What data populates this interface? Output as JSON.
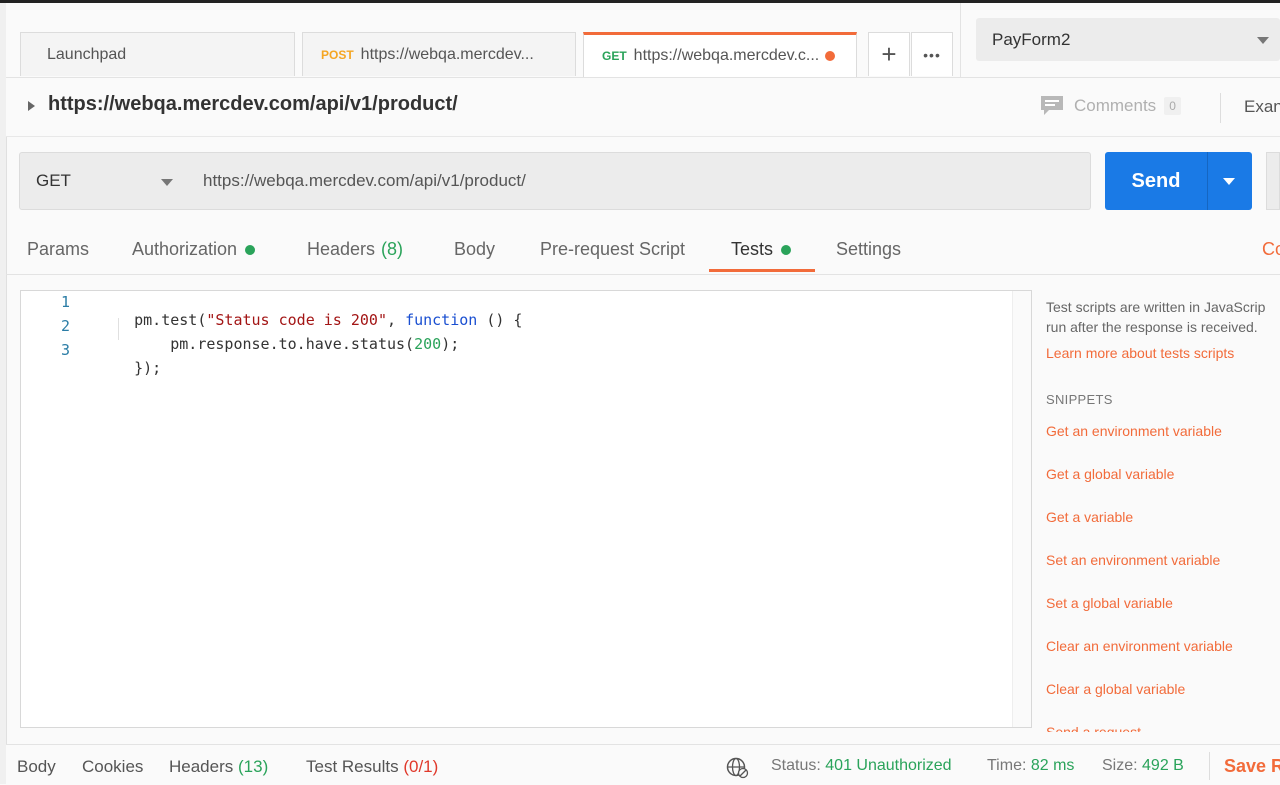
{
  "tabs": [
    {
      "method": "",
      "label": "Launchpad"
    },
    {
      "method": "POST",
      "label": "https://webqa.mercdev..."
    },
    {
      "method": "GET",
      "label": "https://webqa.mercdev.c..."
    }
  ],
  "tab_actions": {
    "add": "+",
    "more": "•••"
  },
  "environment": {
    "selected": "PayForm2"
  },
  "request": {
    "title": "https://webqa.mercdev.com/api/v1/product/",
    "method": "GET",
    "url": "https://webqa.mercdev.com/api/v1/product/"
  },
  "header_right": {
    "comments_label": "Comments",
    "comments_count": "0",
    "examples_label": "Exan"
  },
  "send_label": "Send",
  "subtabs": {
    "params": "Params",
    "authorization": "Authorization",
    "headers": "Headers",
    "headers_count": "(8)",
    "body": "Body",
    "prerequest": "Pre-request Script",
    "tests": "Tests",
    "settings": "Settings",
    "cookies_partial": "Co"
  },
  "editor": {
    "lines": [
      {
        "num": "1",
        "t1": "pm.test(",
        "t2": "\"Status code is 200\"",
        "t3": ", ",
        "t4": "function",
        "t5": " () {"
      },
      {
        "num": "2",
        "t1": "    pm.response.to.have.status(",
        "t2": "200",
        "t3": ");"
      },
      {
        "num": "3",
        "t1": "});"
      }
    ]
  },
  "side_panel": {
    "desc_line1": "Test scripts are written in JavaScrip",
    "desc_line2": "run after the response is received.",
    "learn_more": "Learn more about tests scripts",
    "snippets_heading": "SNIPPETS",
    "snippets": [
      "Get an environment variable",
      "Get a global variable",
      "Get a variable",
      "Set an environment variable",
      "Set a global variable",
      "Clear an environment variable",
      "Clear a global variable",
      "Send a request"
    ]
  },
  "response_bar": {
    "body": "Body",
    "cookies": "Cookies",
    "headers": "Headers",
    "headers_count": "(13)",
    "test_results": "Test Results",
    "test_results_count": "(0/1)",
    "status_label": "Status:",
    "status_value": "401 Unauthorized",
    "time_label": "Time:",
    "time_value": "82 ms",
    "size_label": "Size:",
    "size_value": "492 B",
    "save_response": "Save R"
  },
  "colors": {
    "accent": "#f26b3a",
    "send": "#1a7ae6",
    "success": "#2aa35a",
    "error": "#e0392b"
  },
  "icons": [
    "caret-right-icon",
    "comments-icon",
    "globe-icon",
    "plus-icon",
    "more-icon",
    "chevron-down-icon"
  ]
}
